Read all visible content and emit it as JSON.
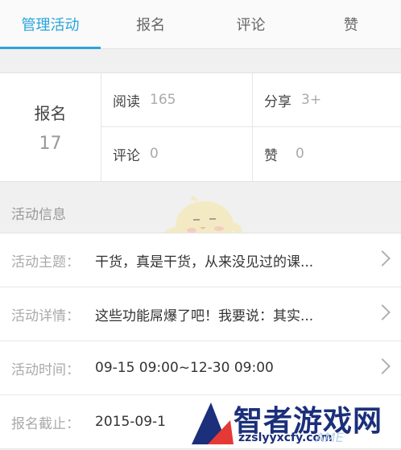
{
  "tabs": [
    {
      "label": "管理活动",
      "active": true
    },
    {
      "label": "报名",
      "active": false
    },
    {
      "label": "评论",
      "active": false
    },
    {
      "label": "赞",
      "active": false
    }
  ],
  "stats": {
    "signup_label": "报名",
    "signup_value": "17",
    "read_label": "阅读",
    "read_value": "165",
    "share_label": "分享",
    "share_value": "3+",
    "comment_label": "评论",
    "comment_value": "0",
    "like_label": "赞",
    "like_value": "0"
  },
  "section_title": "活动信息",
  "info_rows": [
    {
      "key": "活动主题：",
      "value": "干货，真是干货，从来没见过的课..."
    },
    {
      "key": "活动详情：",
      "value": "这些功能屌爆了吧！我要说：其实..."
    },
    {
      "key": "活动时间：",
      "value": "09-15 09:00~12-30 09:00"
    },
    {
      "key": "报名截止：",
      "value": "2015-09-1"
    }
  ],
  "watermark": {
    "text": "智者游戏网",
    "url": "zzslyyxcfy.com",
    "url_suffix": "AME"
  },
  "colors": {
    "accent": "#29a4dc",
    "background": "#f0f0f0"
  }
}
